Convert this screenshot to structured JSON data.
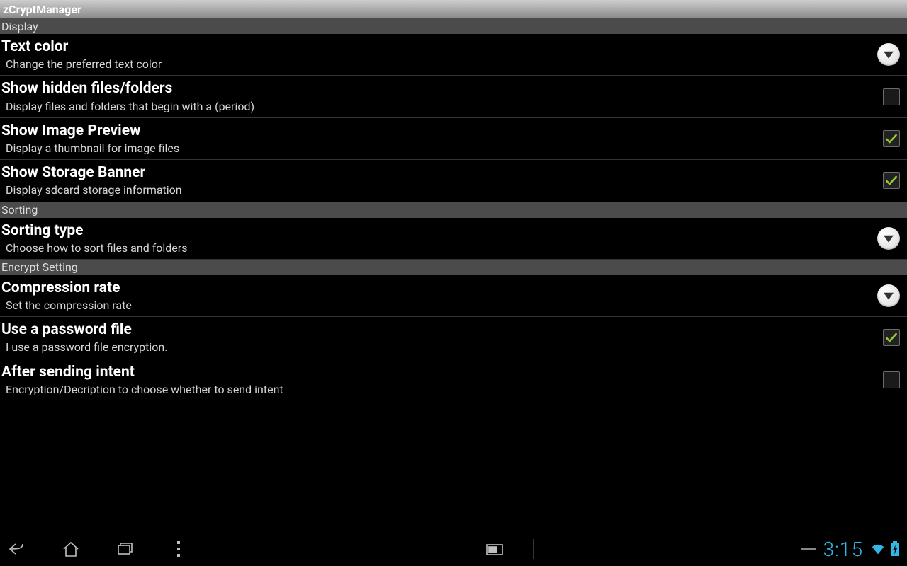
{
  "app": {
    "title": "zCryptManager"
  },
  "sections": {
    "display": {
      "header": "Display"
    },
    "sorting": {
      "header": "Sorting"
    },
    "encrypt": {
      "header": "Encrypt Setting"
    }
  },
  "prefs": {
    "textColor": {
      "title": "Text color",
      "summary": "Change the preferred text color",
      "control": "dropdown"
    },
    "showHidden": {
      "title": "Show hidden files/folders",
      "summary": "Display files and folders that begin with a (period)",
      "control": "checkbox",
      "checked": false
    },
    "imagePreview": {
      "title": "Show Image Preview",
      "summary": "Display a thumbnail for image files",
      "control": "checkbox",
      "checked": true
    },
    "storageBanner": {
      "title": "Show Storage Banner",
      "summary": "Display sdcard storage information",
      "control": "checkbox",
      "checked": true
    },
    "sortingType": {
      "title": "Sorting type",
      "summary": "Choose how to sort files and folders",
      "control": "dropdown"
    },
    "compression": {
      "title": "Compression rate",
      "summary": "Set the compression rate",
      "control": "dropdown"
    },
    "passwordFile": {
      "title": "Use a password file",
      "summary": "I use a password file encryption.",
      "control": "checkbox",
      "checked": true
    },
    "afterIntent": {
      "title": "After sending intent",
      "summary": "Encryption/Decription to choose whether to send intent",
      "control": "checkbox",
      "checked": false
    }
  },
  "statusbar": {
    "time": "3:15"
  }
}
